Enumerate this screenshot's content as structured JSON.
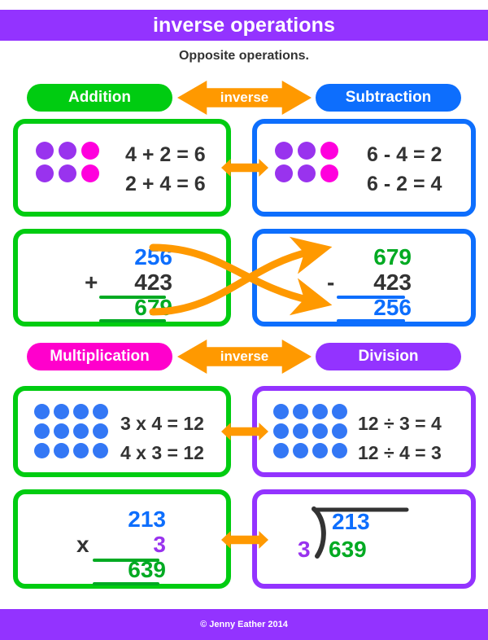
{
  "title": "inverse operations",
  "subtitle": "Opposite operations.",
  "footer": "© Jenny Eather 2014",
  "colors": {
    "purple": "#9333ff",
    "green": "#00cc11",
    "blue": "#0d6efd",
    "magenta": "#ff00cc",
    "orange": "#ff9900",
    "dark": "#333333",
    "dot_purple": "#9933ee",
    "dot_magenta": "#ff00dd",
    "dot_blue": "#3377f5",
    "num_green": "#00aa22"
  },
  "sections": [
    {
      "left_label": "Addition",
      "right_label": "Subtraction",
      "connector_label": "inverse"
    },
    {
      "left_label": "Multiplication",
      "right_label": "Division",
      "connector_label": "inverse"
    }
  ],
  "row1": {
    "left": {
      "dots": {
        "rows": 2,
        "cols": 3,
        "colors": [
          "dot_purple",
          "dot_purple",
          "dot_magenta",
          "dot_purple",
          "dot_purple",
          "dot_magenta"
        ]
      },
      "equations": [
        "4 + 2 = 6",
        "2 + 4 = 6"
      ]
    },
    "right": {
      "dots": {
        "rows": 2,
        "cols": 3,
        "colors": [
          "dot_purple",
          "dot_purple",
          "dot_magenta",
          "dot_purple",
          "dot_purple",
          "dot_magenta"
        ]
      },
      "equations": [
        "6 - 4 = 2",
        "6 - 2 = 4"
      ]
    }
  },
  "row2": {
    "left": {
      "top_number": "256",
      "operator": "+",
      "second_number": "423",
      "answer": "679"
    },
    "right": {
      "top_number": "679",
      "operator": "-",
      "second_number": "423",
      "answer": "256"
    }
  },
  "row3": {
    "left": {
      "dots": {
        "rows": 3,
        "cols": 4,
        "color": "dot_blue"
      },
      "equations": [
        "3 x 4 = 12",
        "4 x 3 = 12"
      ]
    },
    "right": {
      "dots": {
        "rows": 3,
        "cols": 4,
        "color": "dot_blue"
      },
      "equations": [
        "12 ÷ 3 = 4",
        "12 ÷ 4 = 3"
      ]
    }
  },
  "row4": {
    "left": {
      "top_number": "213",
      "operator": "x",
      "second_number": "3",
      "answer": "639"
    },
    "right": {
      "quotient": "213",
      "divisor": "3",
      "dividend": "639"
    }
  }
}
